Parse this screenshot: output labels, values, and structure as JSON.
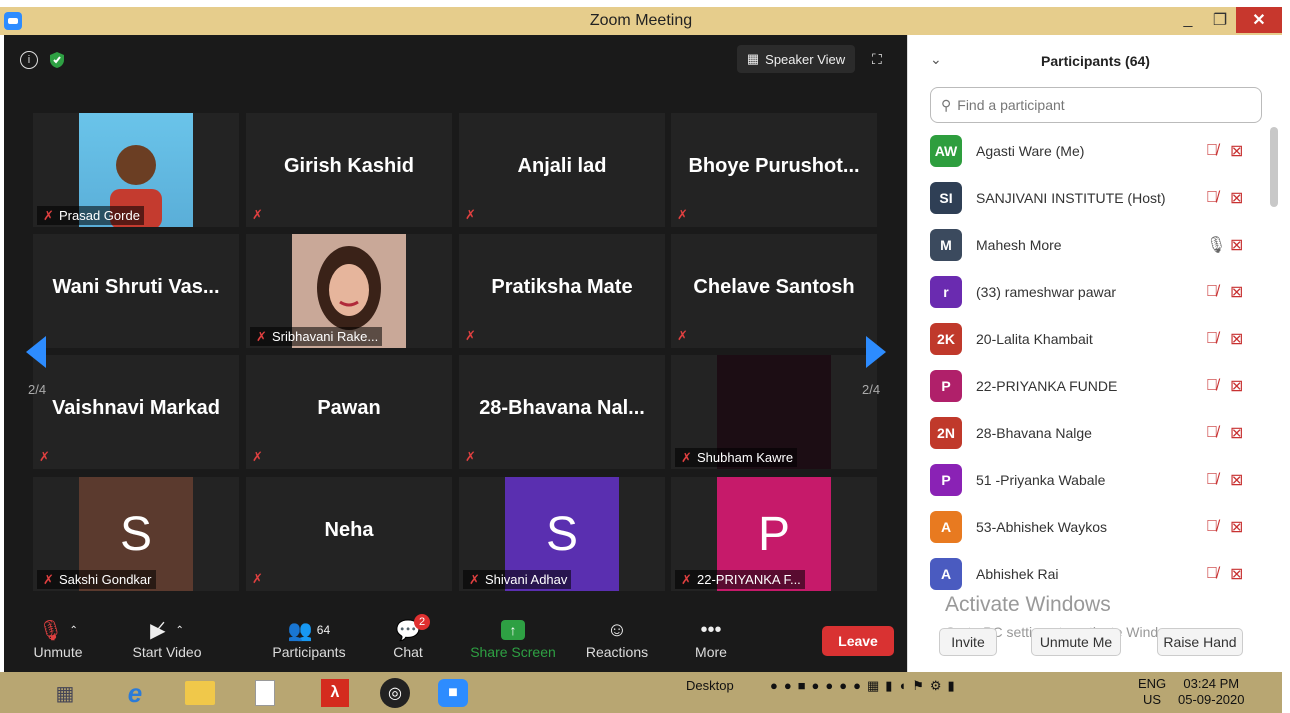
{
  "window": {
    "title": "Zoom Meeting"
  },
  "meeting": {
    "speaker_view_label": "Speaker View",
    "page_left": "2/4",
    "page_right": "2/4",
    "tiles": [
      {
        "name": "",
        "label": "Prasad Gorde"
      },
      {
        "name": "Girish Kashid",
        "label": ""
      },
      {
        "name": "Anjali lad",
        "label": ""
      },
      {
        "name": "Bhoye  Purushot...",
        "label": ""
      },
      {
        "name": "Wani Shruti Vas...",
        "label": ""
      },
      {
        "name": "",
        "label": "Sribhavani Rake..."
      },
      {
        "name": "Pratiksha Mate",
        "label": ""
      },
      {
        "name": "Chelave Santosh",
        "label": ""
      },
      {
        "name": "Vaishnavi Markad",
        "label": ""
      },
      {
        "name": "Pawan",
        "label": ""
      },
      {
        "name": "28-Bhavana  Nal...",
        "label": ""
      },
      {
        "name": "",
        "label": "Shubham Kawre"
      },
      {
        "name": "S",
        "label": "Sakshi Gondkar"
      },
      {
        "name": "Neha",
        "label": ""
      },
      {
        "name": "S",
        "label": "Shivani Adhav"
      },
      {
        "name": "P",
        "label": "22-PRIYANKA F..."
      }
    ]
  },
  "toolbar": {
    "unmute": "Unmute",
    "start_video": "Start Video",
    "participants": "Participants",
    "participants_count": "64",
    "chat": "Chat",
    "chat_badge": "2",
    "share_screen": "Share Screen",
    "reactions": "Reactions",
    "more": "More",
    "leave": "Leave"
  },
  "panel": {
    "title": "Participants (64)",
    "search_placeholder": "Find a participant",
    "participants": [
      {
        "initials": "AW",
        "name": "Agasti Ware (Me)",
        "color": "#2e9e3e"
      },
      {
        "initials": "SI",
        "name": "SANJIVANI INSTITUTE (Host)",
        "color": "#2f3f55"
      },
      {
        "initials": "M",
        "name": "Mahesh More",
        "color": "#3b4a5e"
      },
      {
        "initials": "r",
        "name": "(33) rameshwar pawar",
        "color": "#6a2bb0"
      },
      {
        "initials": "2K",
        "name": "20-Lalita Khambait",
        "color": "#c0392b"
      },
      {
        "initials": "P",
        "name": "22-PRIYANKA FUNDE",
        "color": "#b0206a"
      },
      {
        "initials": "2N",
        "name": "28-Bhavana Nalge",
        "color": "#c0392b"
      },
      {
        "initials": "P",
        "name": "51 -Priyanka Wabale",
        "color": "#8a22b5"
      },
      {
        "initials": "A",
        "name": "53-Abhishek Waykos",
        "color": "#e87a20"
      },
      {
        "initials": "A",
        "name": "Abhishek Rai",
        "color": "#4a5bc0"
      }
    ],
    "invite": "Invite",
    "unmute_me": "Unmute Me",
    "raise_hand": "Raise Hand"
  },
  "watermark": {
    "line1": "Activate Windows",
    "line2": "Go to PC settings to activate Windows."
  },
  "taskbar": {
    "desktop": "Desktop",
    "lang_top": "ENG",
    "lang_bottom": "US",
    "time": "03:24 PM",
    "date": "05-09-2020"
  }
}
